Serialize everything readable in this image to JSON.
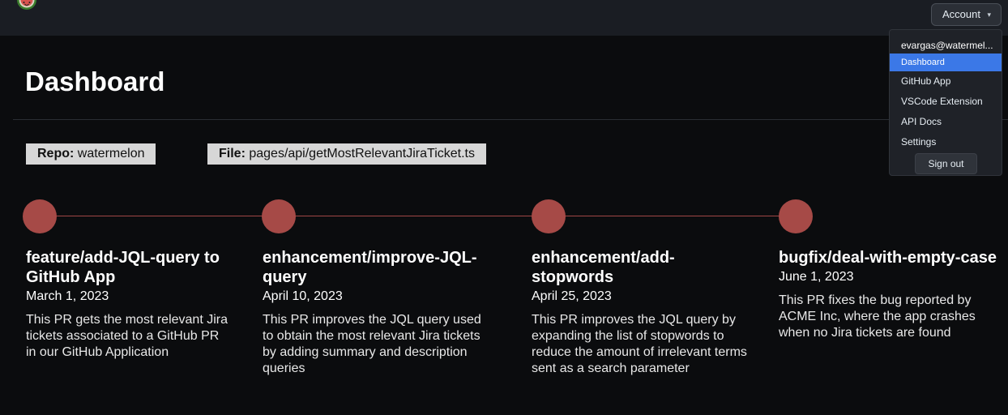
{
  "header": {
    "logo_icon": "watermelon-logo-icon",
    "account_label": "Account",
    "account_caret_icon": "caret-down-icon"
  },
  "page": {
    "title": "Dashboard"
  },
  "tags": {
    "repo_label": "Repo:",
    "repo_value": "watermelon",
    "file_label": "File:",
    "file_value": "pages/api/getMostRelevantJiraTicket.ts"
  },
  "timeline": [
    {
      "title": "feature/add-JQL-query to GitHub App",
      "date": "March 1, 2023",
      "description": "This PR gets the most relevant Jira tickets associated to a GitHub PR in our GitHub Application"
    },
    {
      "title": "enhancement/improve-JQL-query",
      "date": "April 10, 2023",
      "description": "This PR improves the JQL query used to obtain the most relevant Jira tickets by adding summary and description queries"
    },
    {
      "title": "enhancement/add-stopwords",
      "date": "April 25, 2023",
      "description": "This PR improves the JQL query by expanding the list of stopwords to reduce the amount of irrelevant terms sent as a search parameter"
    },
    {
      "title": "bugfix/deal-with-empty-case",
      "date": "June 1, 2023",
      "description": "This PR fixes the bug reported by ACME Inc, where the app crashes when no Jira tickets are found"
    }
  ],
  "dropdown": {
    "email": "evargas@watermel...",
    "items": [
      "Dashboard",
      "GitHub App",
      "VSCode Extension",
      "API Docs",
      "Settings"
    ],
    "active_item": "Dashboard",
    "sign_out": "Sign out"
  },
  "colors": {
    "background": "#0b0c0e",
    "topbar": "#1a1d23",
    "timeline_accent": "#a64a47",
    "tag_background": "#d7d7d7",
    "dropdown_active": "#3b78e7"
  }
}
